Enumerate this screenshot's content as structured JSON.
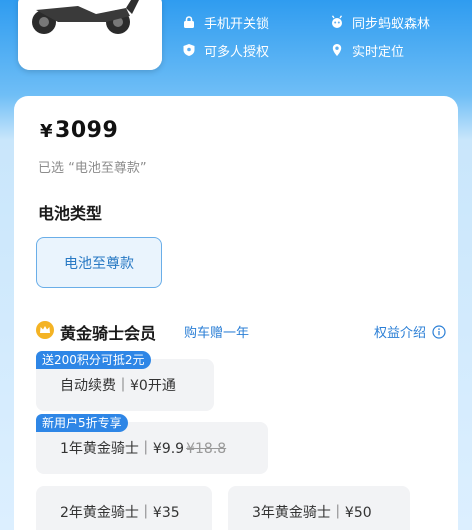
{
  "features": [
    {
      "icon": "lock-icon",
      "label": "手机开关锁"
    },
    {
      "icon": "ant-icon",
      "label": "同步蚂蚁森林"
    },
    {
      "icon": "shield-icon",
      "label": "可多人授权"
    },
    {
      "icon": "location-pin-icon",
      "label": "实时定位"
    }
  ],
  "product": {
    "currency": "¥",
    "price": "3099",
    "selected_text": "已选 “电池至尊款”"
  },
  "battery": {
    "section_title": "电池类型",
    "option": "电池至尊款"
  },
  "membership": {
    "title": "黄金骑士会员",
    "promo": "购车赠一年",
    "benefits_link": "权益介绍",
    "plans": [
      {
        "tag": "送200积分可抵2元",
        "label": "自动续费｜¥0开通"
      },
      {
        "tag": "新用户5折专享",
        "label": "1年黄金骑士｜¥9.9",
        "original_price": "¥18.8"
      },
      {
        "label": "2年黄金骑士｜¥35"
      },
      {
        "label": "3年黄金骑士｜¥50"
      }
    ]
  },
  "colors": {
    "accent_blue": "#2e86e6",
    "header_blue": "#2f9cf0",
    "crown_gold": "#f4b324"
  }
}
